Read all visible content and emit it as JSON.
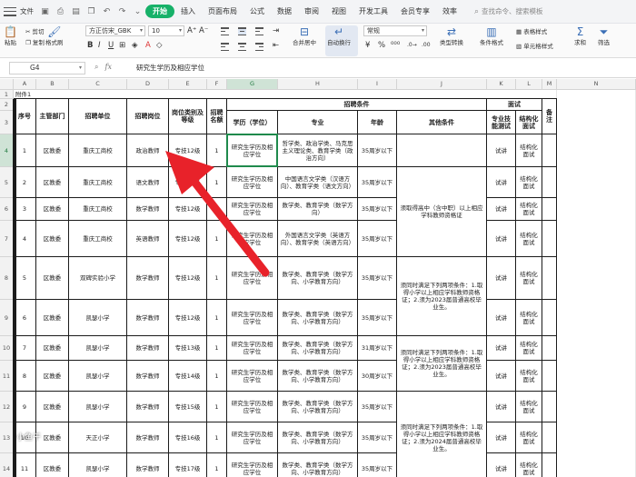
{
  "menubar": {
    "file": "文件",
    "tabs": [
      "开始",
      "插入",
      "页面布局",
      "公式",
      "数据",
      "审阅",
      "视图",
      "开发工具",
      "会员专享",
      "效率"
    ],
    "search_placeholder": "查找命令、搜索模板"
  },
  "ribbon": {
    "paste": "粘贴",
    "cut": "剪切",
    "copy": "复制",
    "format_painter": "格式刷",
    "font_name": "方正仿宋_GBK",
    "font_size": "10",
    "merge_center": "合并居中",
    "wrap_text": "自动换行",
    "number_format": "常规",
    "type_convert": "类型转换",
    "cond_format": "条件格式",
    "table_style": "表格样式",
    "cell_style": "单元格样式",
    "sum": "求和",
    "filter": "筛选"
  },
  "formula_bar": {
    "name_box": "G4",
    "content": "研究生学历及相应学位"
  },
  "columns": [
    "A",
    "B",
    "C",
    "D",
    "E",
    "F",
    "G",
    "H",
    "I",
    "J",
    "K",
    "L",
    "M",
    "N"
  ],
  "sheet": {
    "title_cell": "附件1",
    "headers": {
      "seq": "序号",
      "dept": "主管部门",
      "unit": "招聘单位",
      "post": "招聘岗位",
      "category": "岗位类别及等级",
      "count": "招聘名额",
      "conditions": "招聘条件",
      "edu": "学历（学位）",
      "major": "专业",
      "age": "年龄",
      "other": "其他条件",
      "interview": "面试",
      "skill_test": "专业技能测试",
      "structured": "结构化面试",
      "note": "备注"
    },
    "rows": [
      {
        "row": "4",
        "seq": "1",
        "dept": "区教委",
        "unit": "重庆工商校",
        "post": "政治教师",
        "cat": "专技12级",
        "count": "1",
        "edu": "研究生学历及相应学位",
        "major": "哲学类、政治学类、马克思主义理论类、教育学类（政治方向）",
        "age": "35周岁以下",
        "skill": "试讲",
        "struct": "结构化面试"
      },
      {
        "row": "5",
        "seq": "2",
        "dept": "区教委",
        "unit": "重庆工商校",
        "post": "语文教师",
        "cat": "专技12级",
        "count": "1",
        "edu": "研究生学历及相应学位",
        "major": "中国语言文学类（汉语方向）、教育学类（语文方向）",
        "age": "35周岁以下",
        "skill": "试讲",
        "struct": "结构化面试"
      },
      {
        "row": "6",
        "seq": "3",
        "dept": "区教委",
        "unit": "重庆工商校",
        "post": "数学教师",
        "cat": "专技12级",
        "count": "1",
        "edu": "研究生学历及相应学位",
        "major": "数学类、教育学类（数学方向）",
        "age": "35周岁以下",
        "skill": "试讲",
        "struct": "结构化面试"
      },
      {
        "row": "7",
        "seq": "4",
        "dept": "区教委",
        "unit": "重庆工商校",
        "post": "英语教师",
        "cat": "专技12级",
        "count": "1",
        "edu": "研究生学历及相应学位",
        "major": "外国语言文学类（英语方向）、教育学类（英语方向）",
        "age": "35周岁以下",
        "skill": "试讲",
        "struct": "结构化面试"
      },
      {
        "row": "8",
        "seq": "5",
        "dept": "区教委",
        "unit": "双碑实验小学",
        "post": "数学教师",
        "cat": "专技12级",
        "count": "1",
        "edu": "研究生学历及相应学位",
        "major": "数学类、教育学类（数学方向、小学教育方向）",
        "age": "35周岁以下",
        "skill": "试讲",
        "struct": "结构化面试"
      },
      {
        "row": "9",
        "seq": "6",
        "dept": "区教委",
        "unit": "凯瑟小学",
        "post": "数学教师",
        "cat": "专技12级",
        "count": "1",
        "edu": "研究生学历及相应学位",
        "major": "数学类、教育学类（数学方向、小学教育方向）",
        "age": "35周岁以下",
        "skill": "试讲",
        "struct": "结构化面试"
      },
      {
        "row": "10",
        "seq": "7",
        "dept": "区教委",
        "unit": "凯瑟小学",
        "post": "数学教师",
        "cat": "专技13级",
        "count": "1",
        "edu": "研究生学历及相应学位",
        "major": "数学类、教育学类（数学方向、小学教育方向）",
        "age": "31周岁以下",
        "skill": "试讲",
        "struct": "结构化面试"
      },
      {
        "row": "11",
        "seq": "8",
        "dept": "区教委",
        "unit": "凯瑟小学",
        "post": "数学教师",
        "cat": "专技14级",
        "count": "1",
        "edu": "研究生学历及相应学位",
        "major": "数学类、教育学类（数学方向、小学教育方向）",
        "age": "30周岁以下",
        "skill": "试讲",
        "struct": "结构化面试"
      },
      {
        "row": "12",
        "seq": "9",
        "dept": "区教委",
        "unit": "凯瑟小学",
        "post": "数学教师",
        "cat": "专技15级",
        "count": "1",
        "edu": "研究生学历及相应学位",
        "major": "数学类、教育学类（数学方向、小学教育方向）",
        "age": "35周岁以下",
        "skill": "试讲",
        "struct": "结构化面试"
      },
      {
        "row": "13",
        "seq": "10",
        "dept": "区教委",
        "unit": "天正小学",
        "post": "数学教师",
        "cat": "专技16级",
        "count": "1",
        "edu": "研究生学历及相应学位",
        "major": "数学类、教育学类（数学方向、小学教育方向）",
        "age": "35周岁以下",
        "skill": "试讲",
        "struct": "结构化面试"
      },
      {
        "row": "14",
        "seq": "11",
        "dept": "区教委",
        "unit": "凯瑟小学",
        "post": "数学教师",
        "cat": "专技17级",
        "count": "1",
        "edu": "研究生学历及相应学位",
        "major": "数学类、教育学类（数学方向、小学教育方向）",
        "age": "35周岁以下",
        "skill": "试讲",
        "struct": "结构化面试"
      }
    ],
    "other_a": "须取得高中（含中职）以上相应学科教师资格证",
    "other_b": "须同时满足下列两项条件：1.取得小学以上相应学科教师资格证；2.须为2023届普通高校毕业生。",
    "other_c": "须同时满足下列两项条件：1.取得小学以上相应学科教师资格证；2.须为2023届普通高校毕业生。",
    "other_d": "须同时满足下列两项条件：1.取得小学以上相应学科教师资格证；2.须为2024届普通高校毕业生。"
  },
  "row_numbers": [
    "1",
    "2",
    "3",
    "4",
    "5",
    "6",
    "7",
    "8",
    "9",
    "10",
    "11",
    "12",
    "13",
    "14"
  ],
  "watermark": "小鱼干",
  "colors": {
    "accent": "#17b169",
    "arrow": "#e8222a",
    "selection": "#1f8a4c"
  }
}
